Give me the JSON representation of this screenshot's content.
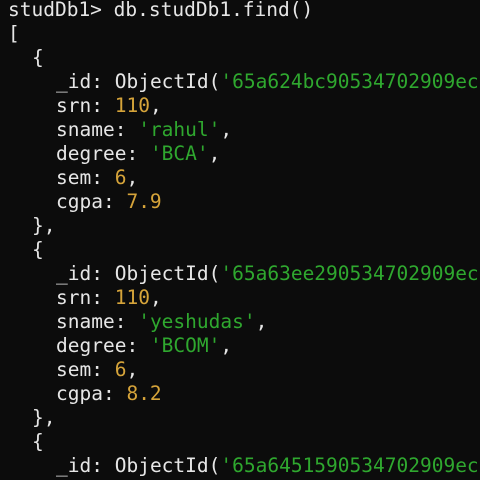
{
  "terminal": {
    "prompt": "studDb1>",
    "command": "db.studDb1.find()",
    "open_bracket": "[",
    "documents": [
      {
        "open": "{",
        "id_key": "_id:",
        "id_call": "ObjectId(",
        "id_value": "'65a624bc90534702909ec",
        "fields": [
          {
            "key": "srn:",
            "value": "110",
            "sep": ",",
            "kind": "num"
          },
          {
            "key": "sname:",
            "value": "'rahul'",
            "sep": ",",
            "kind": "str"
          },
          {
            "key": "degree:",
            "value": "'BCA'",
            "sep": ",",
            "kind": "str"
          },
          {
            "key": "sem:",
            "value": "6",
            "sep": ",",
            "kind": "num"
          },
          {
            "key": "cgpa:",
            "value": "7.9",
            "sep": "",
            "kind": "num"
          }
        ],
        "close": "},"
      },
      {
        "open": "{",
        "id_key": "_id:",
        "id_call": "ObjectId(",
        "id_value": "'65a63ee290534702909ec",
        "fields": [
          {
            "key": "srn:",
            "value": "110",
            "sep": ",",
            "kind": "num"
          },
          {
            "key": "sname:",
            "value": "'yeshudas'",
            "sep": ",",
            "kind": "str"
          },
          {
            "key": "degree:",
            "value": "'BCOM'",
            "sep": ",",
            "kind": "str"
          },
          {
            "key": "sem:",
            "value": "6",
            "sep": ",",
            "kind": "num"
          },
          {
            "key": "cgpa:",
            "value": "8.2",
            "sep": "",
            "kind": "num"
          }
        ],
        "close": "},"
      },
      {
        "open": "{",
        "id_key": "_id:",
        "id_call": "ObjectId(",
        "id_value": "'65a6451590534702909ec",
        "fields": [],
        "close": ""
      }
    ]
  },
  "colors": {
    "background": "#0c0c0c",
    "text": "#e6e6e6",
    "number": "#d6a43a",
    "string": "#2fa82f"
  }
}
